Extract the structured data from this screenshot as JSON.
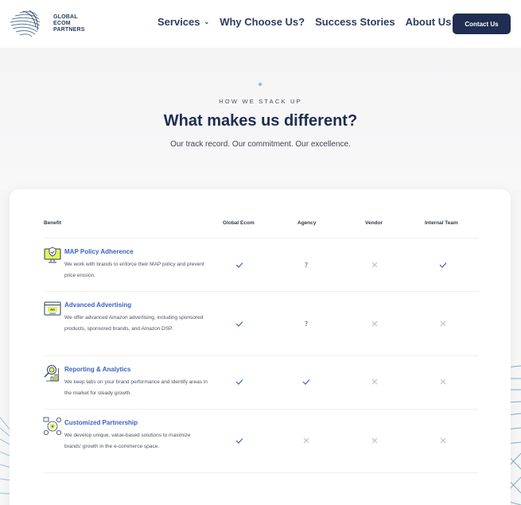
{
  "header": {
    "logo_lines": [
      "GLOBAL",
      "ECOM",
      "PARTNERS"
    ],
    "nav": [
      {
        "label": "Services",
        "has_dropdown": true
      },
      {
        "label": "Why Choose Us?",
        "has_dropdown": false
      },
      {
        "label": "Success Stories",
        "has_dropdown": false
      },
      {
        "label": "About Us",
        "has_dropdown": true
      }
    ],
    "contact_label": "Contact Us"
  },
  "hero": {
    "eyebrow": "HOW WE STACK UP",
    "title": "What makes us different?",
    "subtitle": "Our track record. Our commitment. Our excellence."
  },
  "table": {
    "columns": [
      "Benefit",
      "Global Ecom",
      "Agency",
      "Vendor",
      "Internal Team"
    ],
    "rows": [
      {
        "icon": "monitor-shield-icon",
        "title": "MAP Policy Adherence",
        "description": "We work with brands to enforce their MAP policy and prevent price erosion.",
        "values": [
          "check",
          "question",
          "cross",
          "check"
        ]
      },
      {
        "icon": "ad-browser-icon",
        "title": "Advanced Advertising",
        "description": "We offer advanced Amazon advertising, including sponsored products, sponsored brands, and Amazon DSP.",
        "values": [
          "check",
          "question",
          "cross",
          "cross"
        ]
      },
      {
        "icon": "analytics-magnifier-icon",
        "title": "Reporting & Analytics",
        "description": "We keep tabs on your brand performance and identify areas in the market for steady growth.",
        "values": [
          "check",
          "check",
          "cross",
          "cross"
        ]
      },
      {
        "icon": "partnership-network-icon",
        "title": "Customized Partnership",
        "description": "We develop unique, value-based solutions to maximize brands' growth in the e-commerce space.",
        "values": [
          "check",
          "cross",
          "cross",
          "cross"
        ]
      }
    ],
    "symbols": {
      "question": "?"
    }
  },
  "colors": {
    "brand_navy": "#1f2d52",
    "accent_blue": "#3b62c4",
    "icon_lime": "#e2f35b",
    "cross_gray": "#b9bcc2"
  }
}
